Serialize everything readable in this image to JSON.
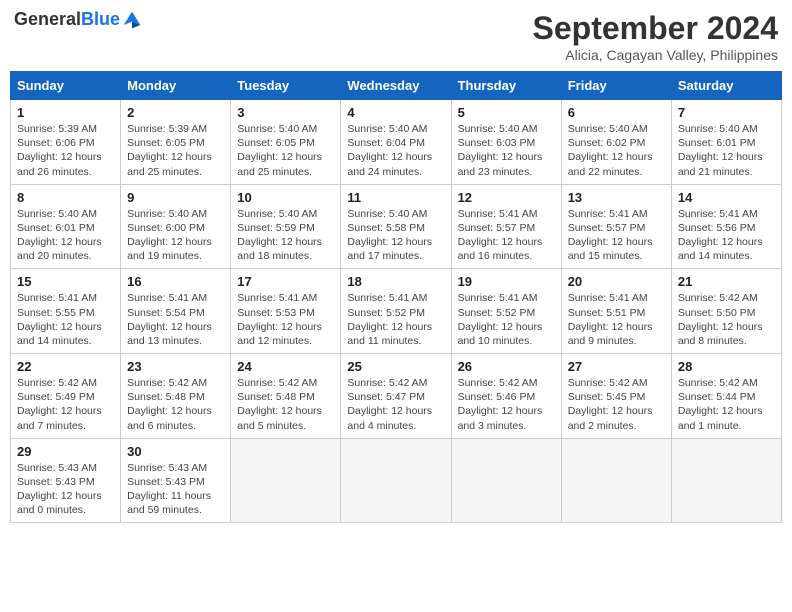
{
  "logo": {
    "line1": "General",
    "line2": "Blue"
  },
  "title": "September 2024",
  "subtitle": "Alicia, Cagayan Valley, Philippines",
  "weekdays": [
    "Sunday",
    "Monday",
    "Tuesday",
    "Wednesday",
    "Thursday",
    "Friday",
    "Saturday"
  ],
  "weeks": [
    [
      {
        "day": "1",
        "info": "Sunrise: 5:39 AM\nSunset: 6:06 PM\nDaylight: 12 hours\nand 26 minutes."
      },
      {
        "day": "2",
        "info": "Sunrise: 5:39 AM\nSunset: 6:05 PM\nDaylight: 12 hours\nand 25 minutes."
      },
      {
        "day": "3",
        "info": "Sunrise: 5:40 AM\nSunset: 6:05 PM\nDaylight: 12 hours\nand 25 minutes."
      },
      {
        "day": "4",
        "info": "Sunrise: 5:40 AM\nSunset: 6:04 PM\nDaylight: 12 hours\nand 24 minutes."
      },
      {
        "day": "5",
        "info": "Sunrise: 5:40 AM\nSunset: 6:03 PM\nDaylight: 12 hours\nand 23 minutes."
      },
      {
        "day": "6",
        "info": "Sunrise: 5:40 AM\nSunset: 6:02 PM\nDaylight: 12 hours\nand 22 minutes."
      },
      {
        "day": "7",
        "info": "Sunrise: 5:40 AM\nSunset: 6:01 PM\nDaylight: 12 hours\nand 21 minutes."
      }
    ],
    [
      {
        "day": "8",
        "info": "Sunrise: 5:40 AM\nSunset: 6:01 PM\nDaylight: 12 hours\nand 20 minutes."
      },
      {
        "day": "9",
        "info": "Sunrise: 5:40 AM\nSunset: 6:00 PM\nDaylight: 12 hours\nand 19 minutes."
      },
      {
        "day": "10",
        "info": "Sunrise: 5:40 AM\nSunset: 5:59 PM\nDaylight: 12 hours\nand 18 minutes."
      },
      {
        "day": "11",
        "info": "Sunrise: 5:40 AM\nSunset: 5:58 PM\nDaylight: 12 hours\nand 17 minutes."
      },
      {
        "day": "12",
        "info": "Sunrise: 5:41 AM\nSunset: 5:57 PM\nDaylight: 12 hours\nand 16 minutes."
      },
      {
        "day": "13",
        "info": "Sunrise: 5:41 AM\nSunset: 5:57 PM\nDaylight: 12 hours\nand 15 minutes."
      },
      {
        "day": "14",
        "info": "Sunrise: 5:41 AM\nSunset: 5:56 PM\nDaylight: 12 hours\nand 14 minutes."
      }
    ],
    [
      {
        "day": "15",
        "info": "Sunrise: 5:41 AM\nSunset: 5:55 PM\nDaylight: 12 hours\nand 14 minutes."
      },
      {
        "day": "16",
        "info": "Sunrise: 5:41 AM\nSunset: 5:54 PM\nDaylight: 12 hours\nand 13 minutes."
      },
      {
        "day": "17",
        "info": "Sunrise: 5:41 AM\nSunset: 5:53 PM\nDaylight: 12 hours\nand 12 minutes."
      },
      {
        "day": "18",
        "info": "Sunrise: 5:41 AM\nSunset: 5:52 PM\nDaylight: 12 hours\nand 11 minutes."
      },
      {
        "day": "19",
        "info": "Sunrise: 5:41 AM\nSunset: 5:52 PM\nDaylight: 12 hours\nand 10 minutes."
      },
      {
        "day": "20",
        "info": "Sunrise: 5:41 AM\nSunset: 5:51 PM\nDaylight: 12 hours\nand 9 minutes."
      },
      {
        "day": "21",
        "info": "Sunrise: 5:42 AM\nSunset: 5:50 PM\nDaylight: 12 hours\nand 8 minutes."
      }
    ],
    [
      {
        "day": "22",
        "info": "Sunrise: 5:42 AM\nSunset: 5:49 PM\nDaylight: 12 hours\nand 7 minutes."
      },
      {
        "day": "23",
        "info": "Sunrise: 5:42 AM\nSunset: 5:48 PM\nDaylight: 12 hours\nand 6 minutes."
      },
      {
        "day": "24",
        "info": "Sunrise: 5:42 AM\nSunset: 5:48 PM\nDaylight: 12 hours\nand 5 minutes."
      },
      {
        "day": "25",
        "info": "Sunrise: 5:42 AM\nSunset: 5:47 PM\nDaylight: 12 hours\nand 4 minutes."
      },
      {
        "day": "26",
        "info": "Sunrise: 5:42 AM\nSunset: 5:46 PM\nDaylight: 12 hours\nand 3 minutes."
      },
      {
        "day": "27",
        "info": "Sunrise: 5:42 AM\nSunset: 5:45 PM\nDaylight: 12 hours\nand 2 minutes."
      },
      {
        "day": "28",
        "info": "Sunrise: 5:42 AM\nSunset: 5:44 PM\nDaylight: 12 hours\nand 1 minute."
      }
    ],
    [
      {
        "day": "29",
        "info": "Sunrise: 5:43 AM\nSunset: 5:43 PM\nDaylight: 12 hours\nand 0 minutes."
      },
      {
        "day": "30",
        "info": "Sunrise: 5:43 AM\nSunset: 5:43 PM\nDaylight: 11 hours\nand 59 minutes."
      },
      {
        "day": "",
        "info": ""
      },
      {
        "day": "",
        "info": ""
      },
      {
        "day": "",
        "info": ""
      },
      {
        "day": "",
        "info": ""
      },
      {
        "day": "",
        "info": ""
      }
    ]
  ]
}
